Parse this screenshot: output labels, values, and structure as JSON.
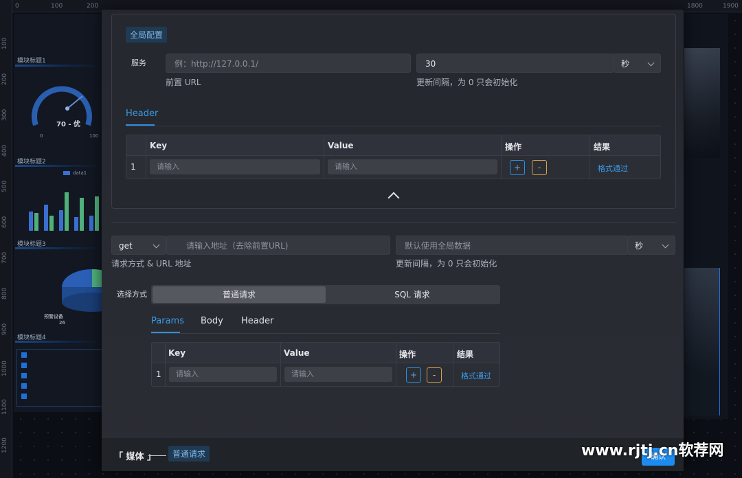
{
  "canvas": {
    "ruler_top_ticks": [
      "0",
      "100",
      "200",
      "1800",
      "1900"
    ],
    "ruler_left_ticks": [
      "100",
      "200",
      "300",
      "400",
      "500",
      "600",
      "700",
      "800",
      "900",
      "1000",
      "1100",
      "1200"
    ],
    "module_titles": [
      "模块标题1",
      "模块标题2",
      "模块标题3",
      "模块标题4"
    ],
    "gauge_value": "70 - 优",
    "gauge_min": "0",
    "gauge_max": "100",
    "legend_data1": "data1",
    "pie_label": "预警设备",
    "pie_value": "26"
  },
  "global_config": {
    "chip": "全局配置",
    "service_label": "服务",
    "url_placeholder": "例：http://127.0.0.1/",
    "url_help": "前置 URL",
    "interval_value": "30",
    "interval_unit": "秒",
    "interval_help": "更新间隔，为 0 只会初始化",
    "tab_header": "Header",
    "table": {
      "headers": [
        "Key",
        "Value",
        "操作",
        "结果"
      ],
      "row_index": "1",
      "key_placeholder": "请输入",
      "value_placeholder": "请输入",
      "add": "+",
      "remove": "-",
      "result": "格式通过"
    }
  },
  "request": {
    "method": "get",
    "address_placeholder": "请输入地址（去除前置URL)",
    "method_help": "请求方式 & URL 地址",
    "interval_placeholder": "默认使用全局数据",
    "interval_unit": "秒",
    "interval_help": "更新间隔，为 0 只会初始化",
    "select_label": "选择方式",
    "modes": [
      "普通请求",
      "SQL 请求"
    ],
    "tabs": [
      "Params",
      "Body",
      "Header"
    ],
    "table": {
      "headers": [
        "Key",
        "Value",
        "操作",
        "结果"
      ],
      "row_index": "1",
      "key_placeholder": "请输入",
      "value_placeholder": "请输入",
      "add": "+",
      "remove": "-",
      "result": "格式通过"
    }
  },
  "footer": {
    "label": "「 媒体 」",
    "chip": "普通请求",
    "confirm": "确认"
  },
  "watermark": "www.rjtj.cn软荐网",
  "colors": {
    "accent": "#2f8fe0",
    "warn": "#d9a24a",
    "modal_bg": "#25282e"
  }
}
